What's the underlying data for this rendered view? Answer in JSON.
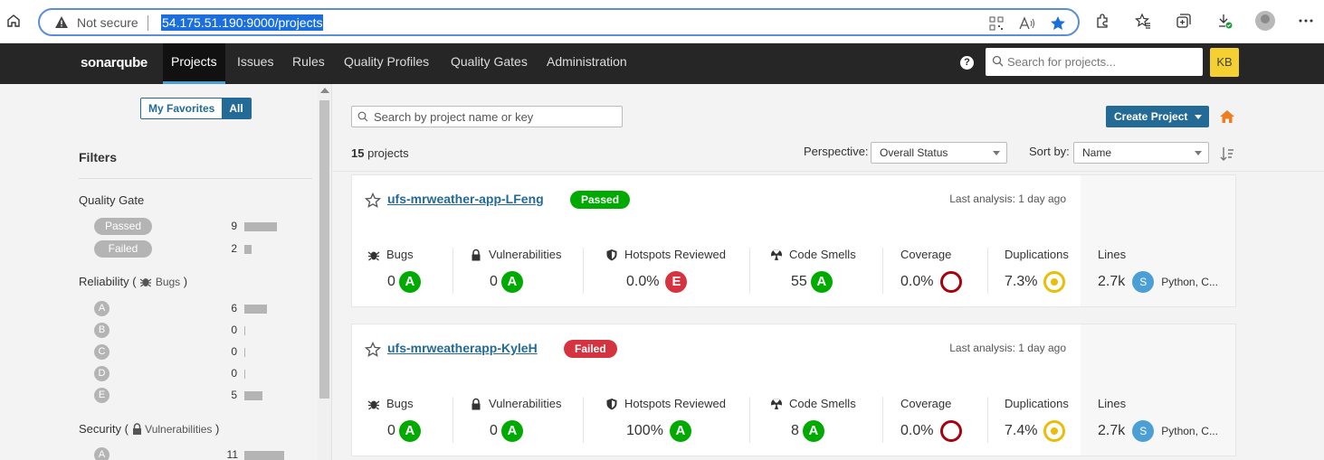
{
  "browser": {
    "not_secure": "Not secure",
    "url": "54.175.51.190:9000/projects"
  },
  "nav": {
    "logo": "sonarqube",
    "items": [
      "Projects",
      "Issues",
      "Rules",
      "Quality Profiles",
      "Quality Gates",
      "Administration"
    ],
    "active": "Projects",
    "help": "?",
    "search_placeholder": "Search for projects...",
    "user_initials": "KB"
  },
  "sidebar": {
    "toggle": {
      "favorites": "My Favorites",
      "all": "All",
      "selected": "All"
    },
    "filters_title": "Filters",
    "quality_gate": {
      "title": "Quality Gate",
      "options": [
        {
          "label": "Passed",
          "count": "9",
          "fraction": 0.82
        },
        {
          "label": "Failed",
          "count": "2",
          "fraction": 0.18
        }
      ]
    },
    "reliability": {
      "title": "Reliability",
      "sub": "Bugs",
      "options": [
        {
          "label": "A",
          "count": "6",
          "fraction": 0.55
        },
        {
          "label": "B",
          "count": "0",
          "fraction": 0
        },
        {
          "label": "C",
          "count": "0",
          "fraction": 0
        },
        {
          "label": "D",
          "count": "0",
          "fraction": 0
        },
        {
          "label": "E",
          "count": "5",
          "fraction": 0.45
        }
      ]
    },
    "security": {
      "title": "Security",
      "sub": "Vulnerabilities",
      "options": [
        {
          "label": "A",
          "count": "11",
          "fraction": 1.0
        }
      ]
    }
  },
  "main": {
    "search_placeholder": "Search by project name or key",
    "create_label": "Create Project",
    "count_num": "15",
    "count_text": "projects",
    "perspective_label": "Perspective:",
    "perspective_value": "Overall Status",
    "sort_label": "Sort by:",
    "sort_value": "Name"
  },
  "metric_labels": {
    "bugs": "Bugs",
    "vulnerabilities": "Vulnerabilities",
    "hotspots": "Hotspots Reviewed",
    "code_smells": "Code Smells",
    "coverage": "Coverage",
    "duplications": "Duplications",
    "lines": "Lines"
  },
  "projects": [
    {
      "name": "ufs-mrweather-app-LFeng",
      "gate": "Passed",
      "last_analysis": "Last analysis: 1 day ago",
      "bugs": "0",
      "bugs_rating": "A",
      "vulnerabilities": "0",
      "vuln_rating": "A",
      "hotspots": "0.0%",
      "hotspots_rating": "E",
      "code_smells": "55",
      "smells_rating": "A",
      "coverage": "0.0%",
      "duplications": "7.3%",
      "lines": "2.7k",
      "size": "S",
      "languages": "Python, C..."
    },
    {
      "name": "ufs-mrweatherapp-KyleH",
      "gate": "Failed",
      "last_analysis": "Last analysis: 1 day ago",
      "bugs": "0",
      "bugs_rating": "A",
      "vulnerabilities": "0",
      "vuln_rating": "A",
      "hotspots": "100%",
      "hotspots_rating": "A",
      "code_smells": "8",
      "smells_rating": "A",
      "coverage": "0.0%",
      "duplications": "7.4%",
      "lines": "2.7k",
      "size": "S",
      "languages": "Python, C..."
    }
  ],
  "colors": {
    "passed": "#00aa00",
    "failed": "#d4333f",
    "rating_a": "#00aa00",
    "rating_e": "#d4333f",
    "coverage_ring": "#a4030f",
    "duplication": "#eabe06",
    "brand_blue": "#236a97",
    "nav_bg": "#262626",
    "home_orange": "#ed7d20"
  }
}
